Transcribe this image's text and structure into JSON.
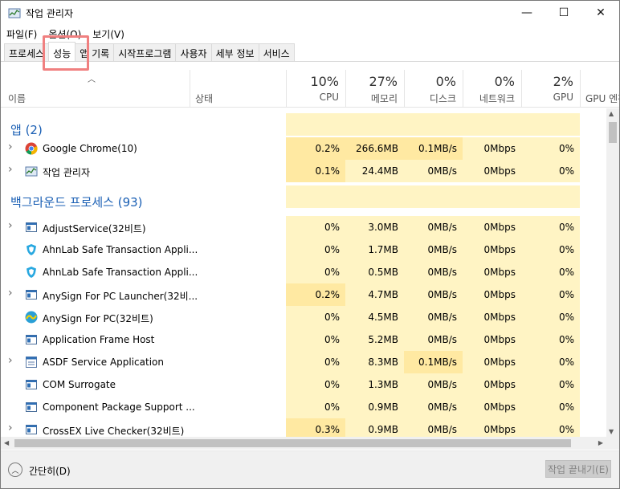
{
  "window": {
    "title": "작업 관리자",
    "controls": {
      "minimize": "—",
      "maximize": "☐",
      "close": "✕"
    }
  },
  "menu": [
    "파일(F)",
    "옵션(O)",
    "보기(V)"
  ],
  "tabs": [
    "프로세스",
    "성능",
    "앱 기록",
    "시작프로그램",
    "사용자",
    "세부 정보",
    "서비스"
  ],
  "active_tab": "성능",
  "columns": {
    "name": "이름",
    "status": "상태",
    "cpu": {
      "pct": "10%",
      "label": "CPU"
    },
    "memory": {
      "pct": "27%",
      "label": "메모리"
    },
    "disk": {
      "pct": "0%",
      "label": "디스크"
    },
    "network": {
      "pct": "0%",
      "label": "네트워크"
    },
    "gpu": {
      "pct": "2%",
      "label": "GPU"
    },
    "gpu_engine": {
      "label": "GPU 엔진"
    }
  },
  "sections": {
    "apps": "앱 (2)",
    "background": "백그라운드 프로세스 (93)"
  },
  "rows": [
    {
      "name": "Google Chrome(10)",
      "icon": "chrome-icon",
      "expandable": true,
      "cpu": "0.2%",
      "memory": "266.6MB",
      "disk": "0.1MB/s",
      "network": "0Mbps",
      "gpu": "0%"
    },
    {
      "name": "작업 관리자",
      "icon": "task-manager-icon",
      "expandable": true,
      "cpu": "0.1%",
      "memory": "24.4MB",
      "disk": "0MB/s",
      "network": "0Mbps",
      "gpu": "0%"
    },
    {
      "name": "AdjustService(32비트)",
      "icon": "window-app-icon",
      "expandable": true,
      "cpu": "0%",
      "memory": "3.0MB",
      "disk": "0MB/s",
      "network": "0Mbps",
      "gpu": "0%"
    },
    {
      "name": "AhnLab Safe Transaction Appli...",
      "icon": "shield-icon",
      "expandable": false,
      "cpu": "0%",
      "memory": "1.7MB",
      "disk": "0MB/s",
      "network": "0Mbps",
      "gpu": "0%"
    },
    {
      "name": "AhnLab Safe Transaction Appli...",
      "icon": "shield-icon",
      "expandable": false,
      "cpu": "0%",
      "memory": "0.5MB",
      "disk": "0MB/s",
      "network": "0Mbps",
      "gpu": "0%"
    },
    {
      "name": "AnySign For PC Launcher(32비...",
      "icon": "window-app-icon",
      "expandable": true,
      "cpu": "0.2%",
      "memory": "4.7MB",
      "disk": "0MB/s",
      "network": "0Mbps",
      "gpu": "0%"
    },
    {
      "name": "AnySign For PC(32비트)",
      "icon": "anysign-icon",
      "expandable": false,
      "cpu": "0%",
      "memory": "4.5MB",
      "disk": "0MB/s",
      "network": "0Mbps",
      "gpu": "0%"
    },
    {
      "name": "Application Frame Host",
      "icon": "window-app-icon",
      "expandable": false,
      "cpu": "0%",
      "memory": "5.2MB",
      "disk": "0MB/s",
      "network": "0Mbps",
      "gpu": "0%"
    },
    {
      "name": "ASDF Service Application",
      "icon": "service-icon",
      "expandable": true,
      "cpu": "0%",
      "memory": "8.3MB",
      "disk": "0.1MB/s",
      "network": "0Mbps",
      "gpu": "0%"
    },
    {
      "name": "COM Surrogate",
      "icon": "window-app-icon",
      "expandable": false,
      "cpu": "0%",
      "memory": "1.3MB",
      "disk": "0MB/s",
      "network": "0Mbps",
      "gpu": "0%"
    },
    {
      "name": "Component Package Support ...",
      "icon": "window-app-icon",
      "expandable": false,
      "cpu": "0%",
      "memory": "0.9MB",
      "disk": "0MB/s",
      "network": "0Mbps",
      "gpu": "0%"
    },
    {
      "name": "CrossEX Live Checker(32비트)",
      "icon": "window-app-icon",
      "expandable": true,
      "cpu": "0.3%",
      "memory": "0.9MB",
      "disk": "0MB/s",
      "network": "0Mbps",
      "gpu": "0%"
    }
  ],
  "footer": {
    "collapse_label": "간단히(D)",
    "end_task_label": "작업 끝내기(E)"
  },
  "colors": {
    "section_title": "#1a5fb4",
    "heat_light": "#fff4c4",
    "heat_medium": "#ffe9a2",
    "highlight_box": "#f08080"
  }
}
